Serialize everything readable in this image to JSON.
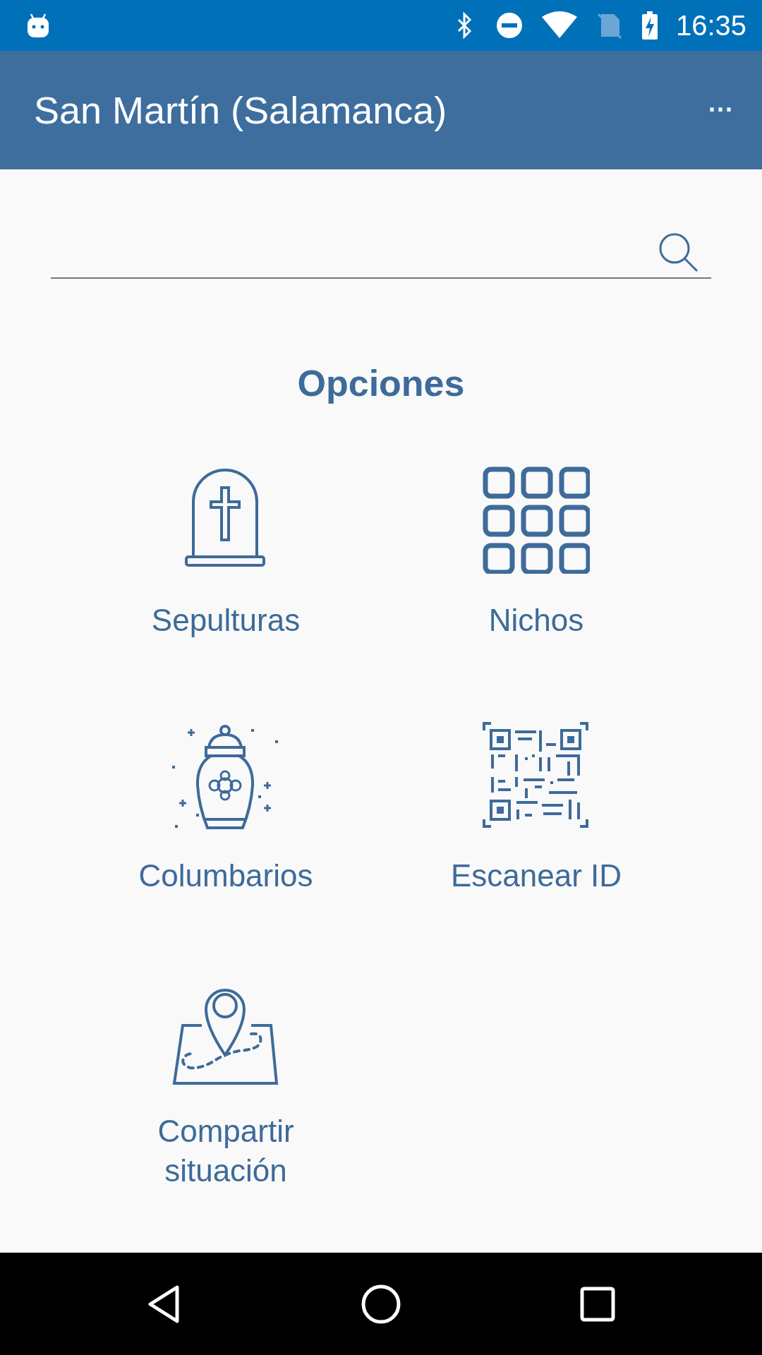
{
  "status_bar": {
    "time": "16:35"
  },
  "toolbar": {
    "title": "San Martín (Salamanca)",
    "menu": "···"
  },
  "section_title": "Opciones",
  "options": [
    {
      "kind": "tombstone",
      "label": "Sepulturas"
    },
    {
      "kind": "niches",
      "label": "Nichos"
    },
    {
      "kind": "urn",
      "label": "Columbarios"
    },
    {
      "kind": "qr",
      "label": "Escanear ID"
    },
    {
      "kind": "map",
      "label": "Compartir situación"
    }
  ]
}
